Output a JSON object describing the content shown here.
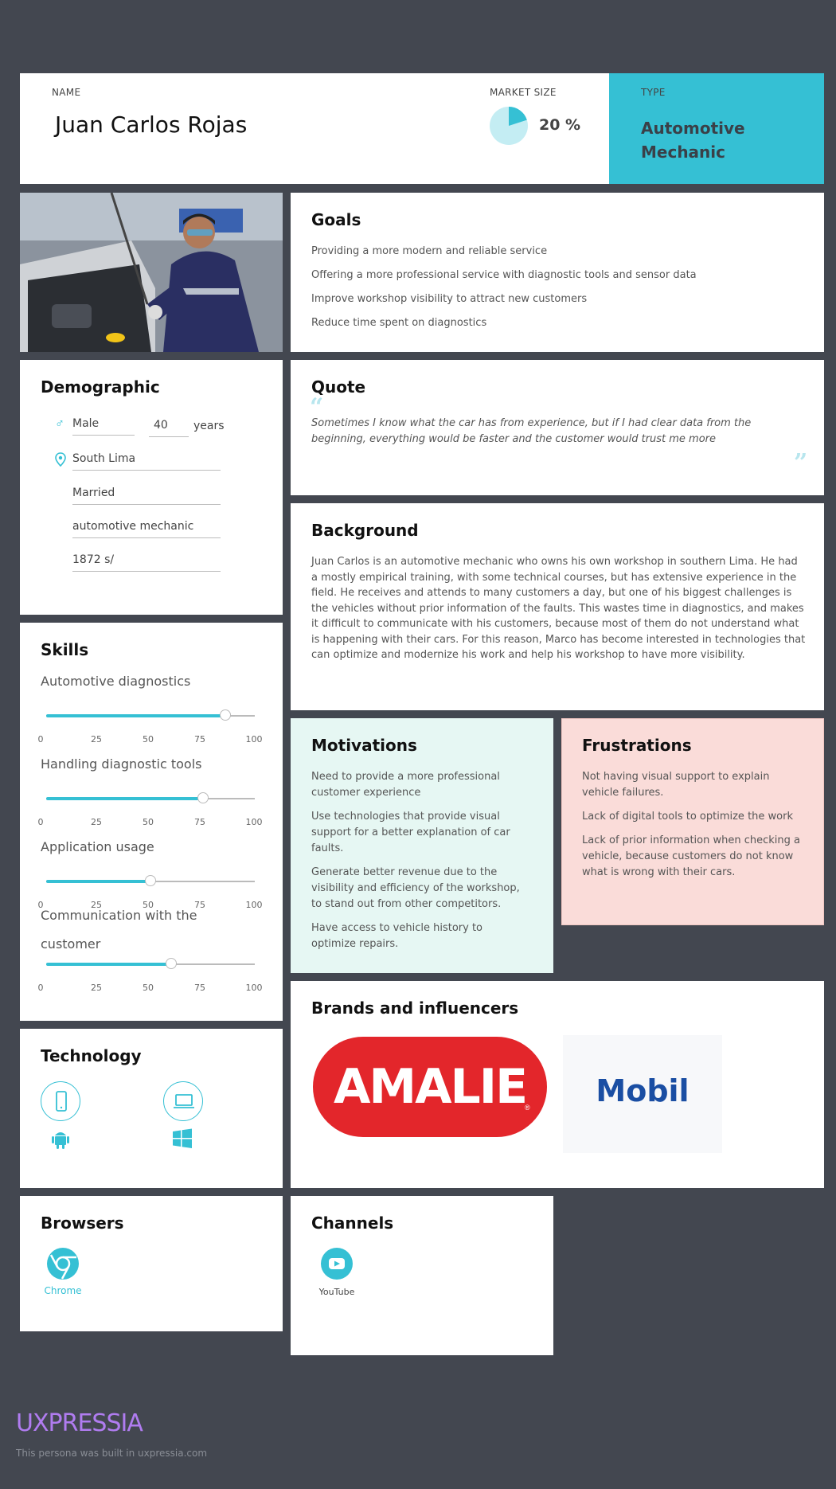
{
  "header": {
    "name_label": "NAME",
    "name": "Juan Carlos Rojas",
    "market_label": "MARKET SIZE",
    "market_value": "20 %",
    "market_percent": 20,
    "type_label": "TYPE",
    "type_value": "Automotive Mechanic"
  },
  "goals": {
    "title": "Goals",
    "items": [
      "Providing a more modern and reliable service",
      "Offering a more professional service with diagnostic tools and sensor data",
      "Improve workshop visibility to attract new customers",
      "Reduce time spent on diagnostics"
    ]
  },
  "demographic": {
    "title": "Demographic",
    "gender": "Male",
    "age": "40",
    "age_unit": "years",
    "location": "South Lima",
    "marital_status": "Married",
    "occupation": "automotive mechanic",
    "income": "1872 s/"
  },
  "quote": {
    "title": "Quote",
    "text": "Sometimes I know what the car has from experience, but if I had clear data from the beginning, everything would be faster and the customer would trust me more"
  },
  "background": {
    "title": "Background",
    "text": "Juan Carlos is an automotive mechanic who owns his own workshop in southern Lima. He had a mostly empirical training, with some technical courses, but has extensive experience in the field. He receives and attends to many customers a day, but one of his biggest challenges is the vehicles without prior information of the faults. This wastes time in diagnostics, and makes it difficult to communicate with his customers, because most of them do not understand what is happening with their cars. For this reason, Marco has become interested in technologies that can optimize and modernize his work and help his workshop to have more visibility."
  },
  "skills": {
    "title": "Skills",
    "ticks": [
      "0",
      "25",
      "50",
      "75",
      "100"
    ],
    "items": [
      {
        "name": "Automotive diagnostics",
        "value": 86
      },
      {
        "name": "Handling diagnostic tools",
        "value": 75
      },
      {
        "name": "Application usage",
        "value": 50
      },
      {
        "name": "Communication with the customer",
        "value": 60
      }
    ]
  },
  "motivations": {
    "title": "Motivations",
    "items": [
      "Need to provide a more professional customer experience",
      "Use technologies that provide visual support for a better explanation of car faults.",
      "Generate better revenue due to the visibility and efficiency of the workshop, to stand out from other competitors.",
      "Have access to vehicle history to optimize repairs."
    ]
  },
  "frustrations": {
    "title": "Frustrations",
    "items": [
      "Not having visual support to explain vehicle failures.",
      "Lack of digital tools to optimize the work",
      "Lack of prior information when checking a vehicle, because customers do not know what is wrong with their cars."
    ]
  },
  "brands": {
    "title": "Brands and influencers",
    "brand1": "AMALIE",
    "brand2": "Mobil"
  },
  "technology": {
    "title": "Technology",
    "icons": [
      "smartphone-icon",
      "laptop-icon",
      "android-icon",
      "windows-icon"
    ]
  },
  "browsers": {
    "title": "Browsers",
    "items": [
      "Chrome"
    ]
  },
  "channels": {
    "title": "Channels",
    "items": [
      "YouTube"
    ]
  },
  "footer": {
    "logo": "UXPRESSIA",
    "note": "This persona was built in uxpressia.com"
  },
  "colors": {
    "accent": "#35c0d4",
    "background": "#434750",
    "motivations_bg": "#e6f7f3",
    "frustrations_bg": "#fadcd9",
    "logo": "#b07cf0"
  }
}
